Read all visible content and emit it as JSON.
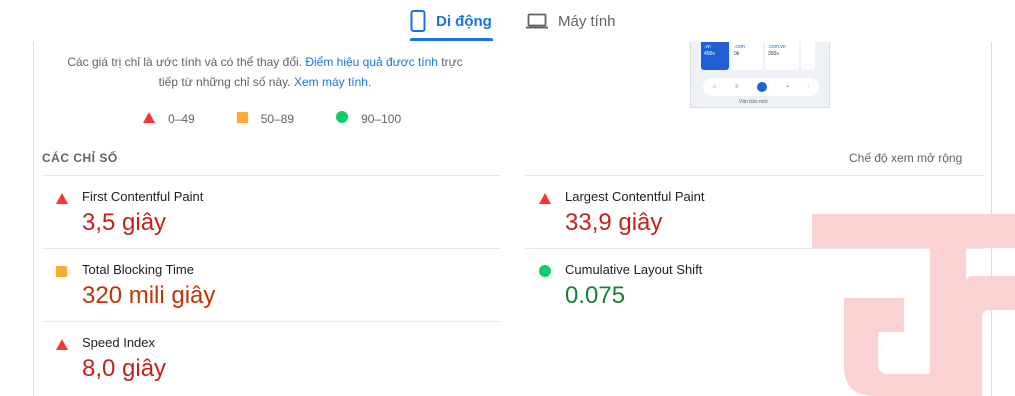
{
  "tabs": [
    {
      "label": "Di động",
      "icon": "phone-icon",
      "active": true
    },
    {
      "label": "Máy tính",
      "icon": "laptop-icon",
      "active": false
    }
  ],
  "disclaimer": {
    "text_before": "Các giá trị chỉ là ước tính và có thể thay đổi. ",
    "link1": "Điểm hiệu quả được tính",
    "text_middle": " trực tiếp từ những chỉ số này. ",
    "link2": "Xem máy tính."
  },
  "legend": [
    {
      "range": "0–49",
      "shape": "triangle",
      "color": "#ff3333"
    },
    {
      "range": "50–89",
      "shape": "square",
      "color": "#ffaa33"
    },
    {
      "range": "90–100",
      "shape": "circle",
      "color": "#0cce6b"
    }
  ],
  "thumbnail": {
    "labels": [
      ".vn",
      "450s",
      ".com",
      "0k",
      ".com.vn",
      "350s",
      "Ván bản mới"
    ]
  },
  "metrics_section": {
    "title": "CÁC CHỈ SỐ",
    "expand_label": "Chế độ xem mở rộng"
  },
  "metrics": [
    {
      "name": "First Contentful Paint",
      "value": "3,5 giây",
      "rating": "fail"
    },
    {
      "name": "Largest Contentful Paint",
      "value": "33,9 giây",
      "rating": "fail"
    },
    {
      "name": "Total Blocking Time",
      "value": "320 mili giây",
      "rating": "average"
    },
    {
      "name": "Cumulative Layout Shift",
      "value": "0.075",
      "rating": "pass"
    },
    {
      "name": "Speed Index",
      "value": "8,0 giây",
      "rating": "fail"
    }
  ],
  "colors": {
    "accent": "#1a73e8",
    "fail": "#c5221f",
    "average": "#c33300",
    "pass": "#188038",
    "watermark": "#f9c9c9"
  }
}
